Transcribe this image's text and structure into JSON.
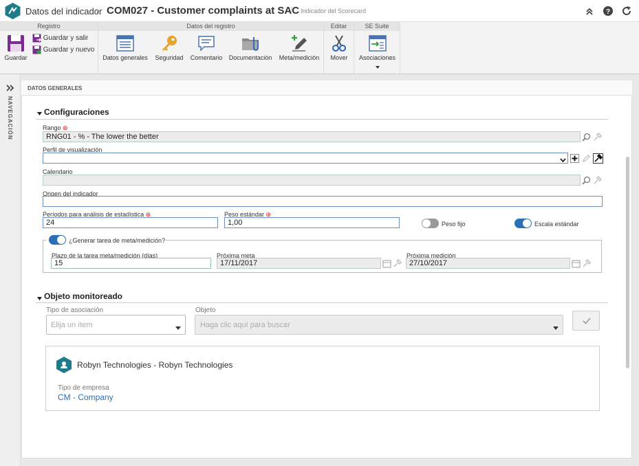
{
  "titlebar": {
    "app_title": "Datos del indicador",
    "separator": "›",
    "record_title": "COM027 - Customer complaints at SAC",
    "subtitle": "Indicador del Scorecard"
  },
  "ribbon": {
    "group_registro": "Registro",
    "save": "Guardar",
    "save_exit": "Guardar y salir",
    "save_new": "Guardar y nuevo",
    "group_datos": "Datos del registro",
    "general": "Datos generales",
    "security": "Seguridad",
    "comment": "Comentario",
    "documentation": "Documentación",
    "goal": "Meta/medición",
    "group_editar": "Editar",
    "move": "Mover",
    "group_suite": "SE Suite",
    "associations": "Asociaciones"
  },
  "nav": {
    "label": "NAVEGACIÓN"
  },
  "panel": {
    "title": "DATOS GENERALES"
  },
  "config": {
    "title": "Configuraciones",
    "range_label": "Rango",
    "range_value": "RNG01 - % - The lower the better",
    "profile_label": "Perfil de visualización",
    "profile_value": "",
    "calendar_label": "Calendario",
    "calendar_value": "",
    "origin_label": "Origen del indicador",
    "origin_value": "",
    "periods_label": "Períodos para análisis de estadística",
    "periods_value": "24",
    "weight_label": "Peso estándar",
    "weight_value": "1,00",
    "fixed_weight_label": "Peso fijo",
    "fixed_weight_on": false,
    "std_scale_label": "Escala estándar",
    "std_scale_on": true,
    "gen_task_label": "¿Generar tarea de meta/medición?",
    "gen_task_on": true,
    "deadline_label": "Plazo de la tarea meta/medición (días)",
    "deadline_value": "15",
    "next_goal_label": "Próxima meta",
    "next_goal_value": "17/11/2017",
    "next_measure_label": "Próxima medición",
    "next_measure_value": "27/10/2017"
  },
  "monitored": {
    "title": "Objeto monitoreado",
    "assoc_type_label": "Tipo de asociación",
    "assoc_type_placeholder": "Elija un ítem",
    "object_label": "Objeto",
    "object_placeholder": "Haga clic aquí para buscar",
    "card_title": "Robyn Technologies - Robyn Technologies",
    "company_type_label": "Tipo de empresa",
    "company_type_value": "CM - Company"
  },
  "colors": {
    "accent": "#2a6fb8",
    "teal": "#1f7a8c",
    "required": "#d00000"
  }
}
